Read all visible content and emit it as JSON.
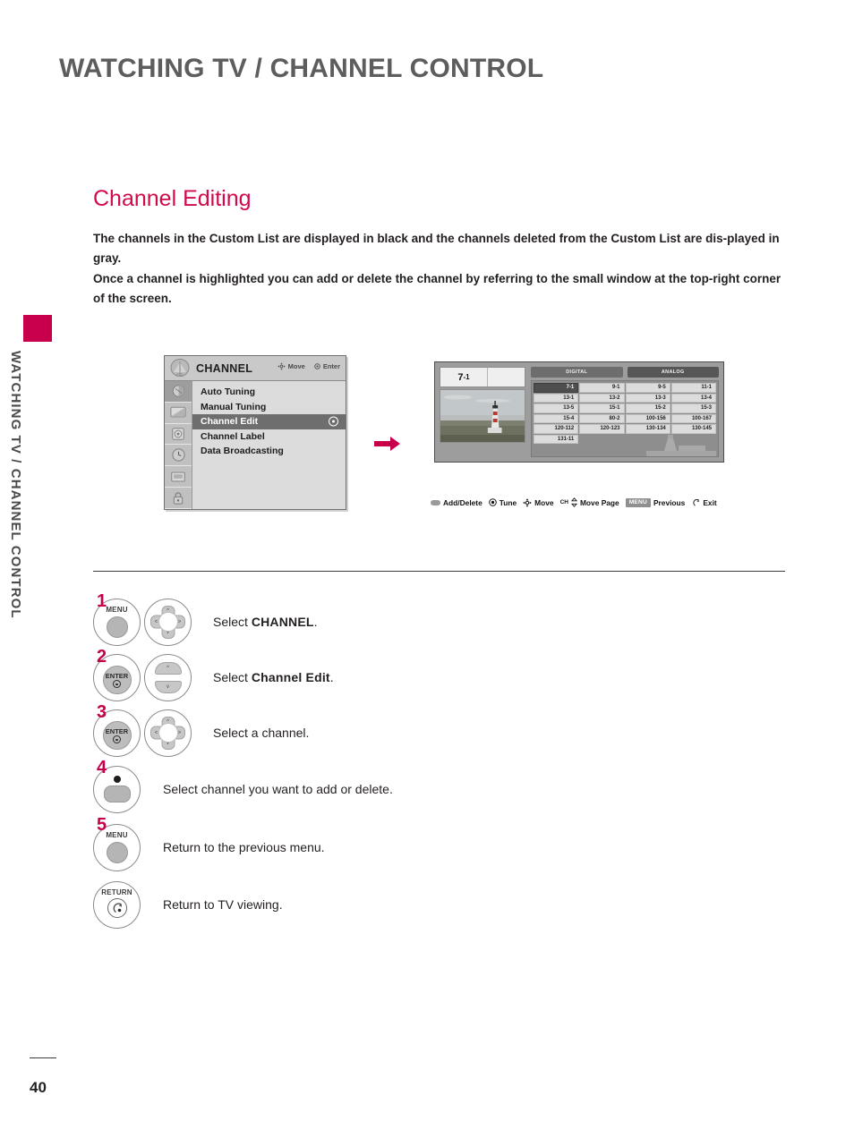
{
  "header": {
    "title": "WATCHING TV / CHANNEL CONTROL"
  },
  "sidebar": {
    "vertical_label": "WATCHING TV / CHANNEL CONTROL",
    "accent_color": "#c8004b"
  },
  "section": {
    "title": "Channel Editing",
    "title_color": "#d10a4a",
    "paragraphs": [
      "The channels in the Custom List are displayed in black and the channels deleted from the Custom List are dis-played in gray.",
      "Once a channel is highlighted you can add or delete the channel by referring to the small window at the top-right corner of the screen."
    ]
  },
  "osd_menu": {
    "title": "CHANNEL",
    "hints": [
      {
        "icon": "dpad-icon",
        "label": "Move"
      },
      {
        "icon": "enter-dot-icon",
        "label": "Enter"
      }
    ],
    "rail_icons": [
      "channel-icon",
      "picture-icon",
      "audio-icon",
      "time-icon",
      "option-icon",
      "lock-icon"
    ],
    "items": [
      {
        "label": "Auto Tuning",
        "selected": false
      },
      {
        "label": "Manual Tuning",
        "selected": false
      },
      {
        "label": "Channel Edit",
        "selected": true
      },
      {
        "label": "Channel Label",
        "selected": false
      },
      {
        "label": "Data Broadcasting",
        "selected": false
      }
    ]
  },
  "tv_screen": {
    "preview_channel": "7",
    "preview_channel_sub": "-1",
    "tabs": [
      {
        "label": "DIGITAL",
        "active": true
      },
      {
        "label": "ANALOG",
        "active": false
      }
    ],
    "grid_rows": [
      [
        "7-1",
        "9-1",
        "9-5",
        "11-1"
      ],
      [
        "13-1",
        "13-2",
        "13-3",
        "13-4"
      ],
      [
        "13-5",
        "15-1",
        "15-2",
        "15-3"
      ],
      [
        "15-4",
        "80-2",
        "100-156",
        "100-167"
      ],
      [
        "120-112",
        "120-123",
        "130-134",
        "130-145"
      ],
      [
        "131-11",
        "",
        "",
        ""
      ]
    ],
    "highlighted_cell": "7-1",
    "legend": [
      {
        "icon": "oval-key-icon",
        "label": "Add/Delete"
      },
      {
        "icon": "enter-dot-icon",
        "label": "Tune"
      },
      {
        "icon": "dpad-icon",
        "label": "Move"
      },
      {
        "icon": "ch-updown-icon",
        "prefix": "CH",
        "label": "Move Page"
      },
      {
        "icon": "menu-key-icon",
        "key": "MENU",
        "label": "Previous"
      },
      {
        "icon": "return-icon",
        "label": "Exit"
      }
    ]
  },
  "steps": [
    {
      "num": "1",
      "key": "MENU",
      "nav": "dpad",
      "text_prefix": "Select ",
      "text_bold": "CHANNEL",
      "text_suffix": "."
    },
    {
      "num": "2",
      "key": "ENTER",
      "nav": "updown",
      "text_prefix": "Select ",
      "text_bold": "Channel Edit",
      "text_suffix": "."
    },
    {
      "num": "3",
      "key": "ENTER",
      "nav": "dpad",
      "text_prefix": "Select a channel.",
      "text_bold": "",
      "text_suffix": ""
    },
    {
      "num": "4",
      "key": "OVAL",
      "nav": "none",
      "text_prefix": "Select channel you want to add or delete.",
      "text_bold": "",
      "text_suffix": ""
    },
    {
      "num": "5",
      "key": "MENU",
      "nav": "none",
      "text_prefix": "Return to the previous menu.",
      "text_bold": "",
      "text_suffix": ""
    },
    {
      "num": "",
      "key": "RETURN",
      "nav": "none",
      "text_prefix": "Return to TV viewing.",
      "text_bold": "",
      "text_suffix": ""
    }
  ],
  "footer": {
    "page_number": "40"
  }
}
